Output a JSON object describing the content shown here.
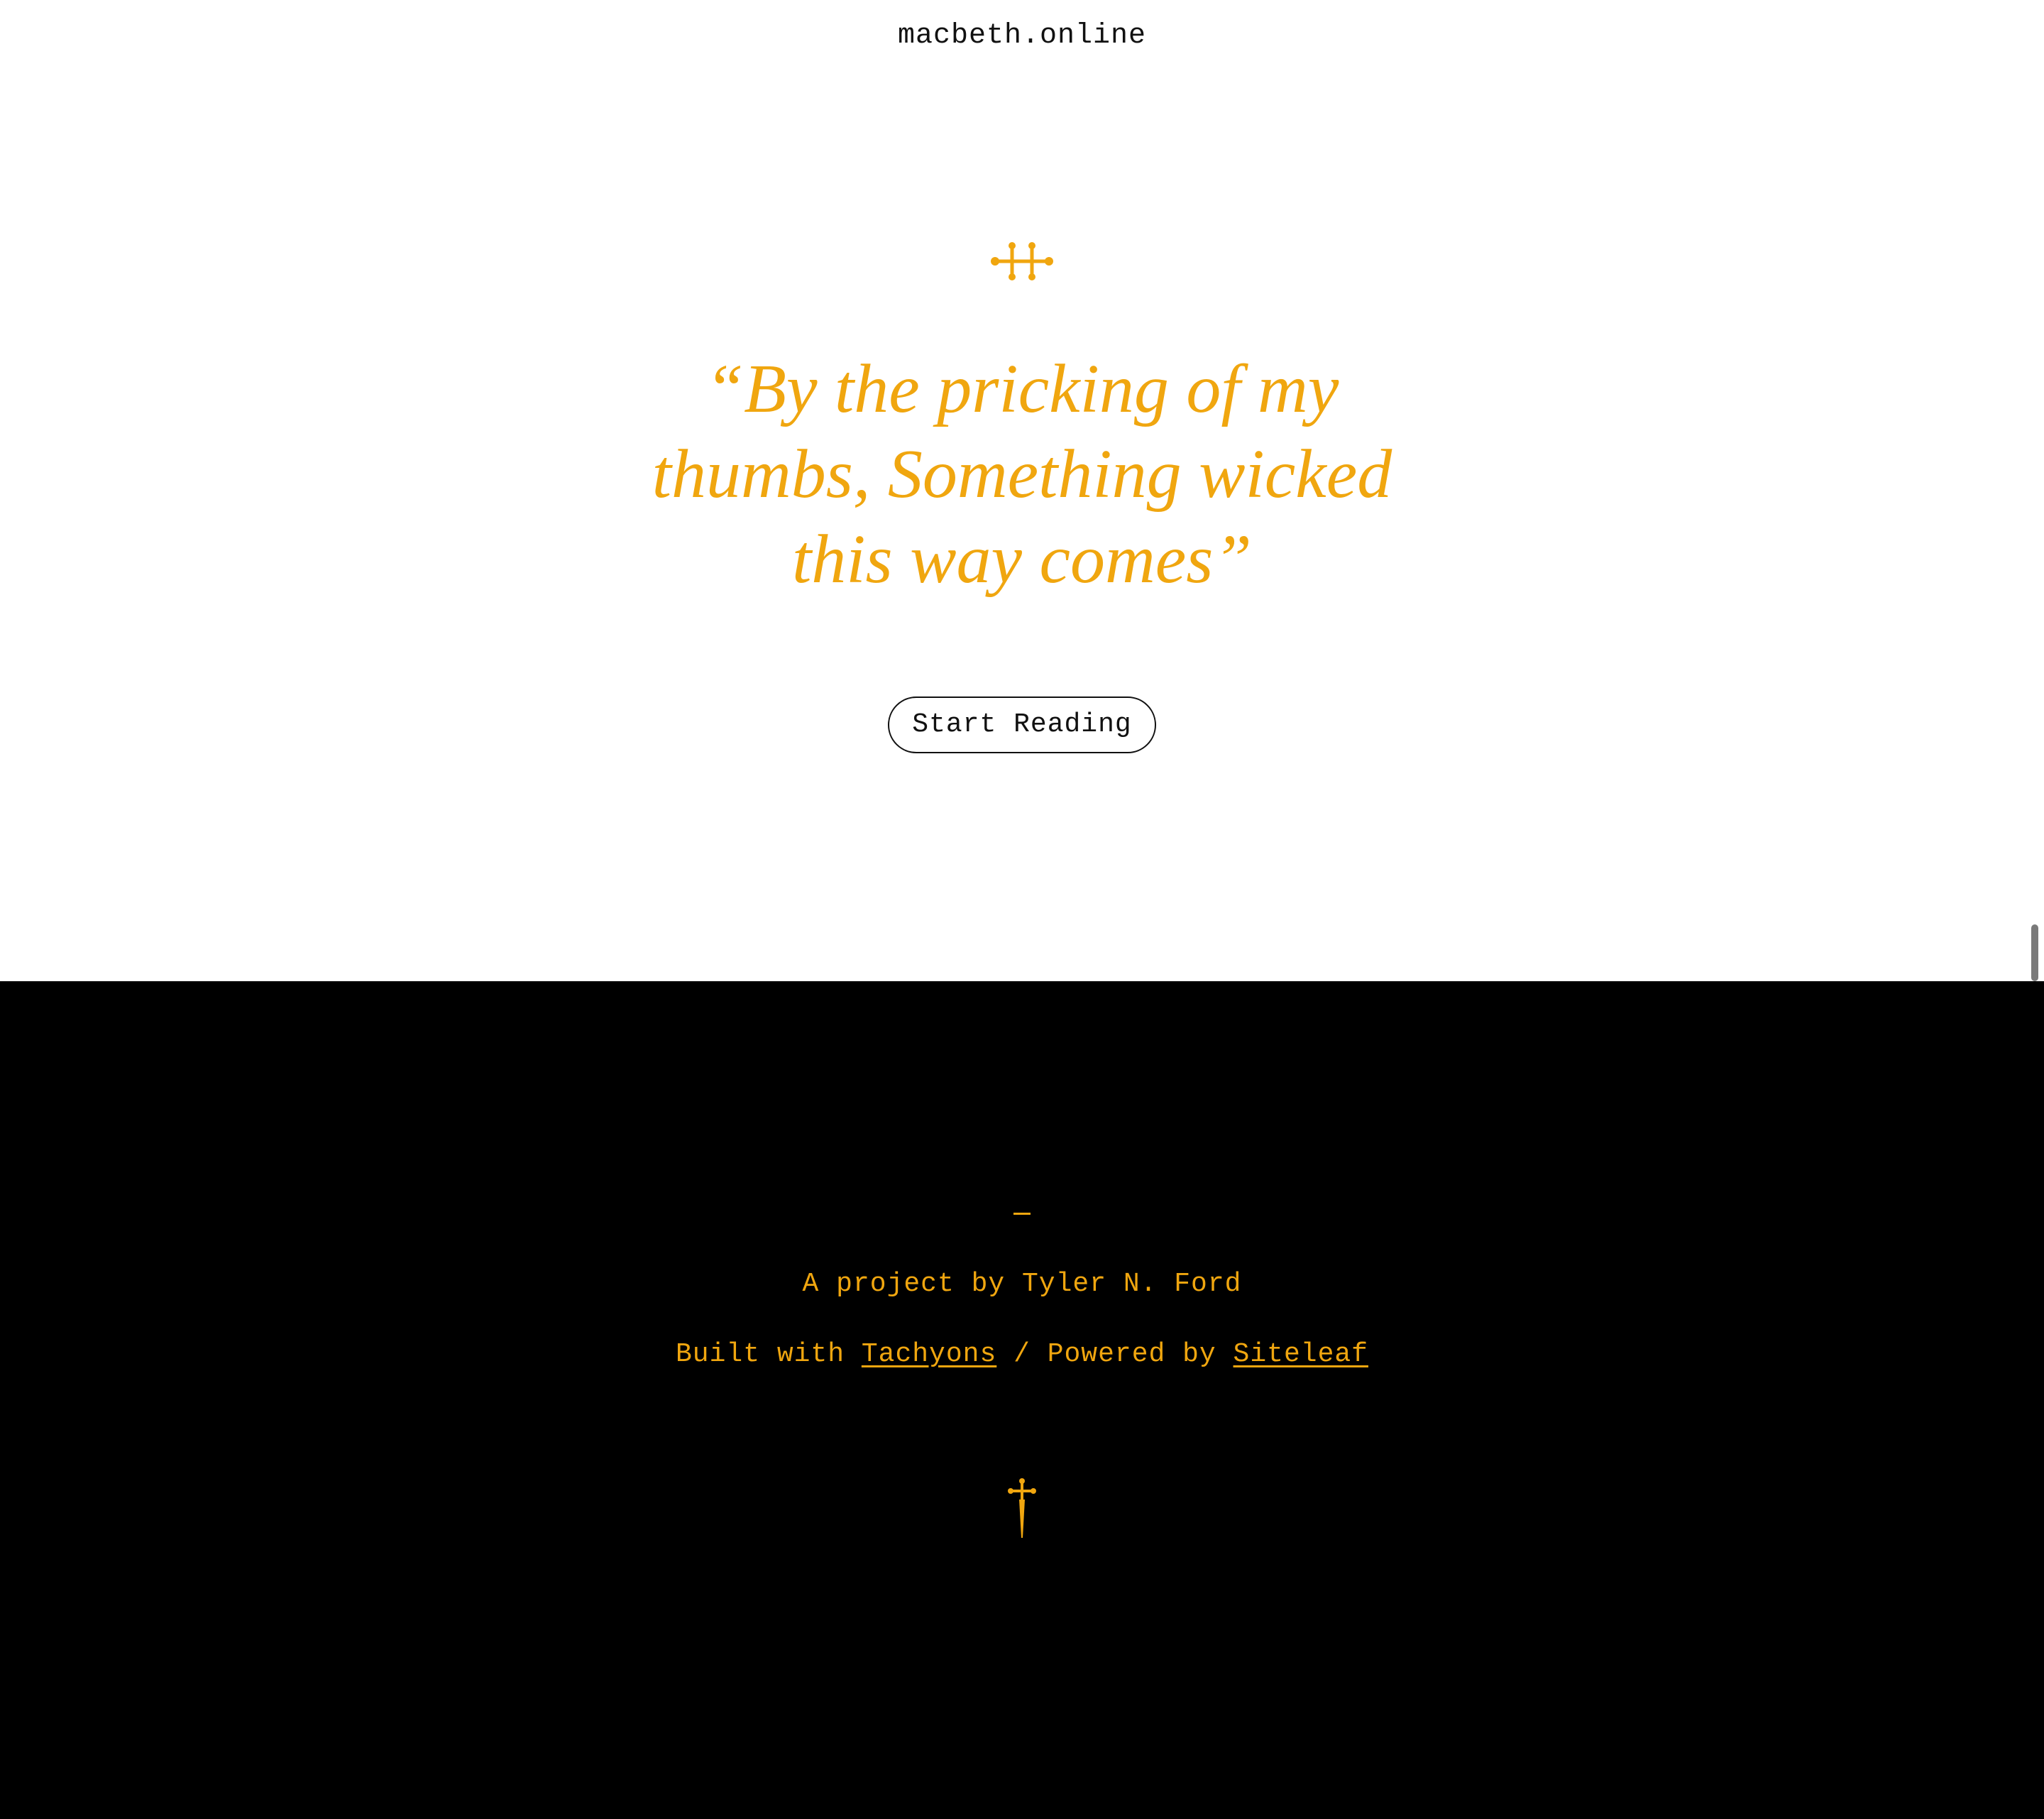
{
  "header": {
    "site_title": "macbeth.online"
  },
  "hero": {
    "ornament_icon": "fleuron-icon",
    "quote_lines": [
      "“By the pricking of my",
      "thumbs, Something wicked",
      "this way comes”"
    ],
    "cta_label": "Start Reading"
  },
  "footer": {
    "credit": "A project by Tyler N. Ford",
    "built_prefix": "Built with ",
    "built_link": "Tachyons",
    "separator": " / Powered by ",
    "powered_link": "Siteleaf",
    "bottom_icon": "dagger-icon"
  },
  "colors": {
    "accent": "#f0a60f",
    "text": "#111111",
    "footer_bg": "#000000",
    "page_bg": "#ffffff"
  }
}
